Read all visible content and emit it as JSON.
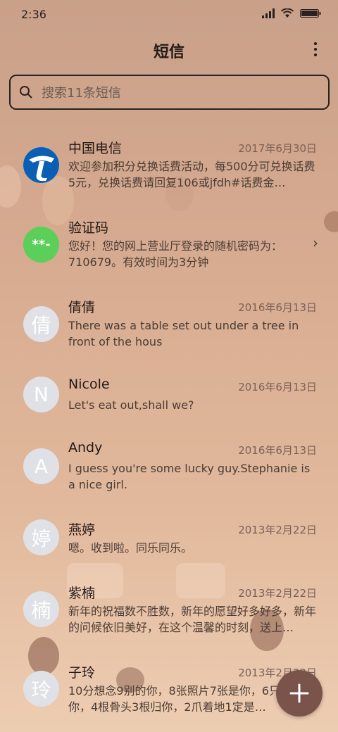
{
  "status_bar": {
    "time": "2:36",
    "icons": [
      "signal-icon",
      "wifi-icon",
      "battery-icon"
    ]
  },
  "header": {
    "title": "短信",
    "menu_icon": "more-vertical-icon"
  },
  "search": {
    "placeholder": "搜索11条短信",
    "icon": "search-icon"
  },
  "conversations": [
    {
      "name": "中国电信",
      "date": "2017年6月30日",
      "preview": "欢迎参加积分兑换话费活动，每500分可兑换话费5元，兑换话费请回复106或jfdh#话费金…",
      "avatar_type": "logo-china-telecom"
    },
    {
      "name": "验证码",
      "date": "",
      "preview": "您好！您的网上营业厅登录的随机密码为：710679。有效时间为3分钟",
      "avatar_type": "verification-code",
      "avatar_text": "**-"
    },
    {
      "name": "倩倩",
      "date": "2016年6月13日",
      "preview": "There was a table set out under a tree in front of the hous",
      "avatar_text": "倩"
    },
    {
      "name": "Nicole",
      "date": "2016年6月13日",
      "preview": "Let's eat out,shall we?",
      "avatar_text": "N"
    },
    {
      "name": "Andy",
      "date": "2016年6月13日",
      "preview": "I guess you're some lucky guy.Stephanie is a nice girl.",
      "avatar_text": "A"
    },
    {
      "name": "燕婷",
      "date": "2013年2月22日",
      "preview": "嗯。收到啦。同乐同乐。",
      "avatar_text": "婷"
    },
    {
      "name": "紫楠",
      "date": "2013年2月22日",
      "preview": "新年的祝福数不胜数，新年的愿望好多好多，新年的问候依旧美好，在这个温馨的时刻，送上…",
      "avatar_text": "楠"
    },
    {
      "name": "子玲",
      "date": "2013年2月22日",
      "preview": "10分想念9别的你，8张照片7张是你，6只…只像你，4根骨头3根归你，2爪着地1定是…",
      "avatar_text": "玲"
    }
  ],
  "fab": {
    "icon": "plus-icon"
  },
  "colors": {
    "accent": "#7a544a",
    "avatar_bg": "#dfe1e6",
    "verify_avatar": "#5ccf5a",
    "telecom_blue": "#0a5fb4"
  }
}
